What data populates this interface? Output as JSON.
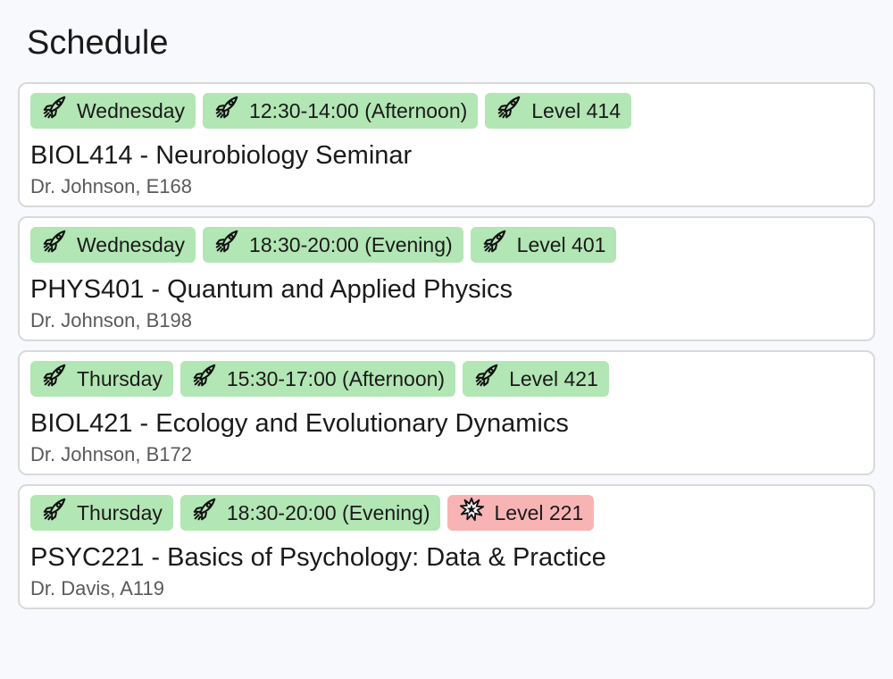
{
  "page": {
    "title": "Schedule"
  },
  "courses": [
    {
      "day": "Wednesday",
      "time": "12:30-14:00 (Afternoon)",
      "level": "Level 414",
      "level_status": "ok",
      "name": "BIOL414 - Neurobiology Seminar",
      "meta": "Dr. Johnson, E168"
    },
    {
      "day": "Wednesday",
      "time": "18:30-20:00 (Evening)",
      "level": "Level 401",
      "level_status": "ok",
      "name": "PHYS401 - Quantum and Applied Physics",
      "meta": "Dr. Johnson, B198"
    },
    {
      "day": "Thursday",
      "time": "15:30-17:00 (Afternoon)",
      "level": "Level 421",
      "level_status": "ok",
      "name": "BIOL421 - Ecology and Evolutionary Dynamics",
      "meta": "Dr. Johnson, B172"
    },
    {
      "day": "Thursday",
      "time": "18:30-20:00 (Evening)",
      "level": "Level 221",
      "level_status": "conflict",
      "name": "PSYC221 - Basics of Psychology: Data & Practice",
      "meta": "Dr. Davis, A119"
    }
  ],
  "icons": {
    "ok": "rocket-icon",
    "conflict": "explosion-icon"
  },
  "colors": {
    "ok_tag": "#b2e6b4",
    "conflict_tag": "#f8b4b4",
    "background": "#f8f9fd"
  }
}
